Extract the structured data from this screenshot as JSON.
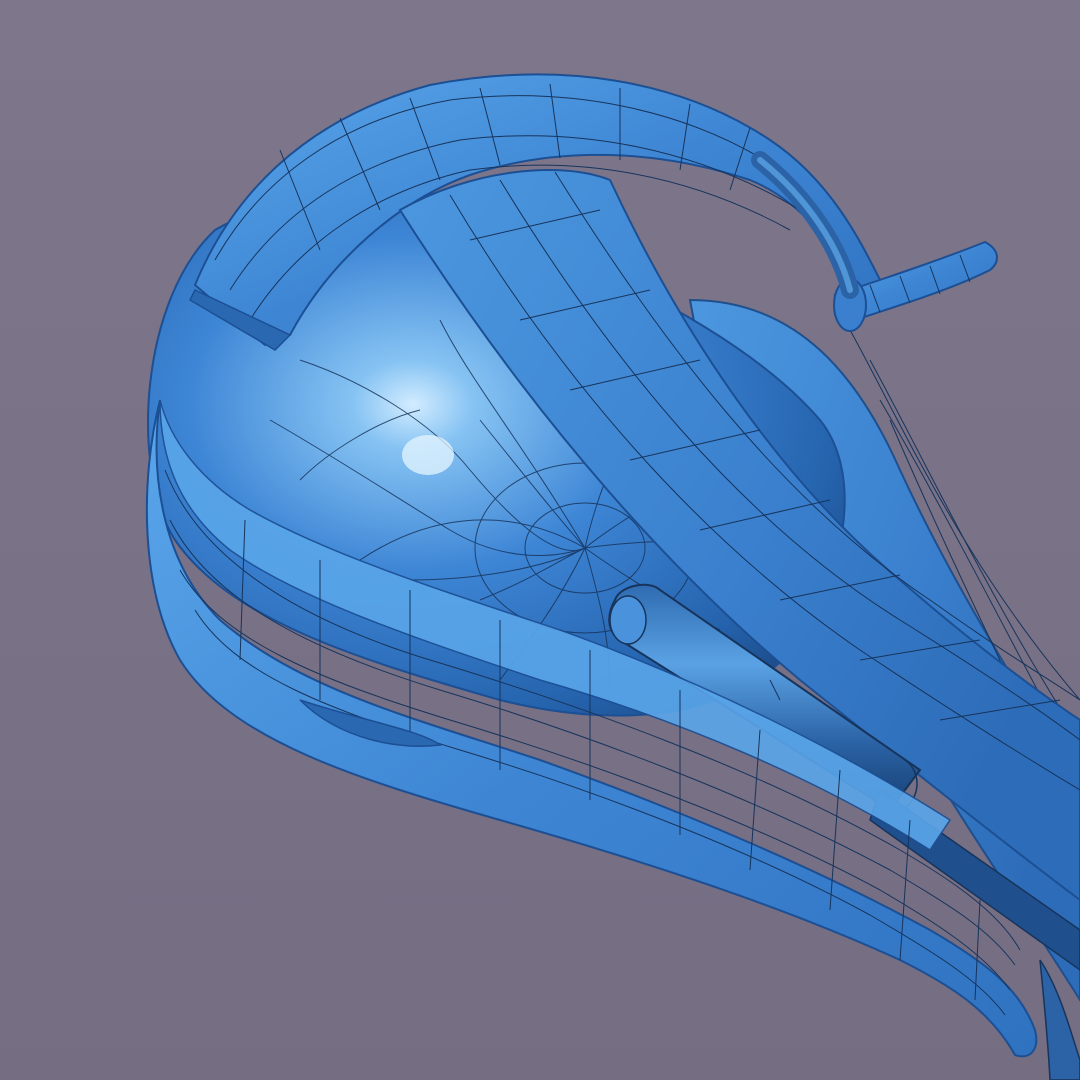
{
  "scene": {
    "subject": "wireframe-3d-model-render",
    "colors": {
      "background": "#7a7286",
      "model_base": "#3f86d6",
      "model_light": "#8cc8f5",
      "model_dark": "#1c4f93",
      "wire": "#17345c"
    }
  }
}
